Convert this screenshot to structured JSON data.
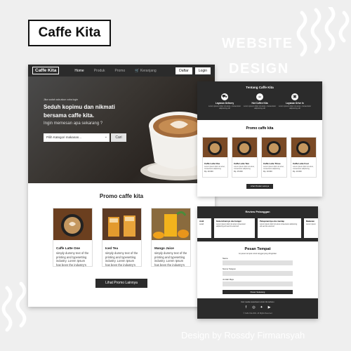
{
  "logo": "Caffe Kita",
  "watermark": {
    "line1": "WEBSITE",
    "line2": "DESIGN"
  },
  "credit": "Design by Rossdy Firmansyah",
  "colors": {
    "dark": "#2b2b2b",
    "background": "#efefef",
    "accent": "#ffffff"
  },
  "main": {
    "nav": {
      "brand": "Caffe Kita",
      "links": [
        "Home",
        "Produk",
        "Promo",
        "Keranjang"
      ],
      "login_signup": "Daftar",
      "login": "Login"
    },
    "hero": {
      "small": "Jika sudah ada akun coba login",
      "headline_1": "Seduh kopimu dan nikmati",
      "headline_2": "bersama",
      "headline_brand": "caffe kita.",
      "subheading": "Ingin memesan apa sekarang ?",
      "select_placeholder": "Pilih Kategori makanan...",
      "search_button": "Cari"
    },
    "promo_title": "Promo caffe kita",
    "cards": [
      {
        "name": "Caffe Latte One",
        "desc": "simply dummy text of the printing and typesetting industry. Lorem Ipsum has been the industry's"
      },
      {
        "name": "Iced Tea",
        "desc": "simply dummy text of the printing and typesetting industry. Lorem Ipsum has been the industry's"
      },
      {
        "name": "Mango Juice",
        "desc": "simply dummy text of the printing and typesetting industry. Lorem Ipsum has been the industry's"
      }
    ],
    "more_button": "Lihat Promo Lainnya"
  },
  "right_top": {
    "about_title": "Tentang Caffe Kita",
    "features": [
      {
        "title": "Layanan Delivery",
        "desc": "Lorem ipsum dolor sit amet, consectetur adipiscing elit"
      },
      {
        "title": "Hot Coffee Kita",
        "desc": "Lorem ipsum dolor sit amet, consectetur adipiscing elit"
      },
      {
        "title": "Layanan Drive In",
        "desc": "Lorem ipsum dolor sit amet, consectetur adipiscing elit"
      }
    ],
    "promo_title": "Promo caffe kita",
    "products": [
      {
        "name": "Caffe Latte One",
        "desc": "Lorem ipsum dolor sit amet, consectetur adipiscing",
        "price": "Rp. 20.000"
      },
      {
        "name": "Caffe Latte Two",
        "desc": "Lorem ipsum dolor sit amet, consectetur adipiscing",
        "price": "Rp. 15.000"
      },
      {
        "name": "Caffe Latte Three",
        "desc": "Lorem ipsum dolor sit amet, consectetur adipiscing",
        "price": "Rp. 10.000"
      },
      {
        "name": "Caffe Latte Four",
        "desc": "Lorem ipsum dolor sit amet, consectetur adipiscing",
        "price": "Rp. 10.000"
      }
    ],
    "more_button": "Lihat Produk Lainnya"
  },
  "right_bottom": {
    "review_title": "Review Pelanggan",
    "reviews": [
      {
        "name": "Andi",
        "text": "sekali"
      },
      {
        "name": "Kebersihannya oke banget",
        "text": "Lorem ipsum dolor sit amet consectetur adipiscing elit sed do eiusmod"
      },
      {
        "name": "Pelayanannya oke mantap",
        "text": "Lorem ipsum dolor sit amet consectetur adipiscing elit sed do eiusmod"
      },
      {
        "name": "Makanan",
        "text": "Lorem ipsum"
      }
    ],
    "form_title": "Pesan Tempat",
    "form_subtitle": "Isi pesan tempat untuk tanggal yang diinginkan",
    "labels": [
      "Nama",
      "Nomor Telepon",
      "Jumlah Meja"
    ],
    "send_button": "Pesan Sekarang",
    "footer_text": "Ikuti media sosial kami untuk info terbaru",
    "social_icons": [
      "facebook-icon",
      "instagram-icon",
      "twitter-icon",
      "youtube-icon"
    ],
    "copyright": "© Caffe Kita 2021. All Rights Reserved"
  }
}
